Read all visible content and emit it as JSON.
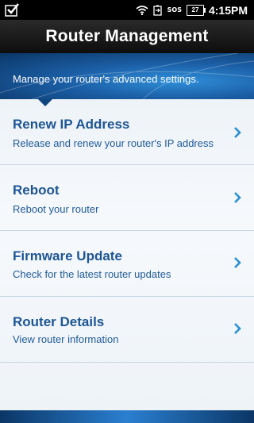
{
  "status_bar": {
    "icons": [
      "check-icon",
      "wifi-icon",
      "battery-saver-icon",
      "sos-signal-icon",
      "battery-icon"
    ],
    "sos_label": "SOS",
    "battery_level": "27",
    "time": "4:15PM"
  },
  "header": {
    "title": "Router Management",
    "subtitle": "Manage your router's advanced settings."
  },
  "menu": {
    "items": [
      {
        "title": "Renew IP Address",
        "subtitle": "Release and renew your router's IP address",
        "icon": "chevron-right-icon"
      },
      {
        "title": "Reboot",
        "subtitle": "Reboot your router",
        "icon": "chevron-right-icon"
      },
      {
        "title": "Firmware Update",
        "subtitle": "Check for the latest router updates",
        "icon": "chevron-right-icon"
      },
      {
        "title": "Router Details",
        "subtitle": "View router information",
        "icon": "chevron-right-icon"
      }
    ]
  },
  "colors": {
    "accent": "#1d5595",
    "chevron": "#2a8fd6",
    "title_bar": "#111111"
  }
}
